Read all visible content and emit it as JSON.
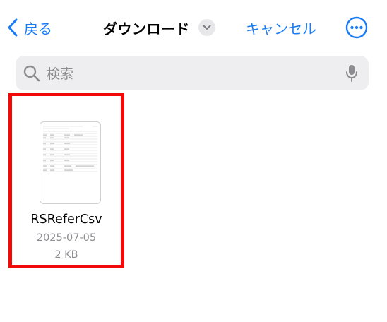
{
  "nav": {
    "back_label": "戻る",
    "title": "ダウンロード",
    "cancel_label": "キャンセル"
  },
  "search": {
    "placeholder": "検索"
  },
  "files": [
    {
      "name": "RSReferCsv",
      "date": "2025-07-05",
      "size": "2 KB"
    }
  ],
  "colors": {
    "accent": "#1a7cf5",
    "highlight_border": "#f00a0a",
    "search_bg": "#eeeef0",
    "secondary_text": "#8e8e93"
  },
  "icons": {
    "back": "chevron-left-icon",
    "title_menu": "chevron-down-icon",
    "more": "ellipsis-circle-icon",
    "search": "magnifying-glass-icon",
    "voice": "microphone-icon"
  }
}
